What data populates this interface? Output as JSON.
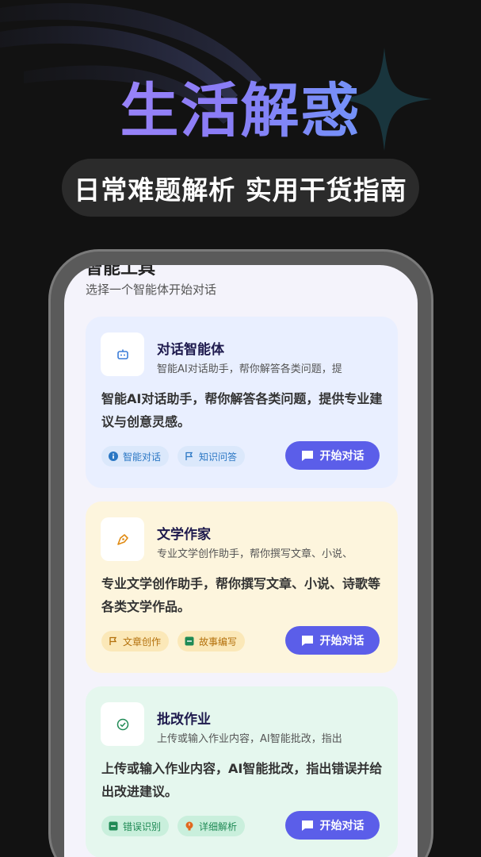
{
  "hero": {
    "title": "生活解惑",
    "subtitle": "日常难题解析 实用干货指南"
  },
  "screen": {
    "header": "智能工具",
    "subheader": "选择一个智能体开始对话"
  },
  "cards": [
    {
      "title": "对话智能体",
      "brief": "智能AI对话助手，帮你解答各类问题，提",
      "desc": "智能AI对话助手，帮你解答各类问题，提供专业建议与创意灵感。",
      "tags": [
        "智能对话",
        "知识问答"
      ],
      "button": "开始对话",
      "icon": "robot-icon"
    },
    {
      "title": "文学作家",
      "brief": "专业文学创作助手，帮你撰写文章、小说、",
      "desc": "专业文学创作助手，帮你撰写文章、小说、诗歌等各类文学作品。",
      "tags": [
        "文章创作",
        "故事编写"
      ],
      "button": "开始对话",
      "icon": "pen-nib-icon"
    },
    {
      "title": "批改作业",
      "brief": "上传或输入作业内容，AI智能批改，指出",
      "desc": "上传或输入作业内容，AI智能批改，指出错误并给出改进建议。",
      "tags": [
        "错误识别",
        "详细解析"
      ],
      "button": "开始对话",
      "icon": "check-circle-icon"
    }
  ],
  "colors": {
    "accent": "#5b5ee9",
    "background": "#121212"
  }
}
